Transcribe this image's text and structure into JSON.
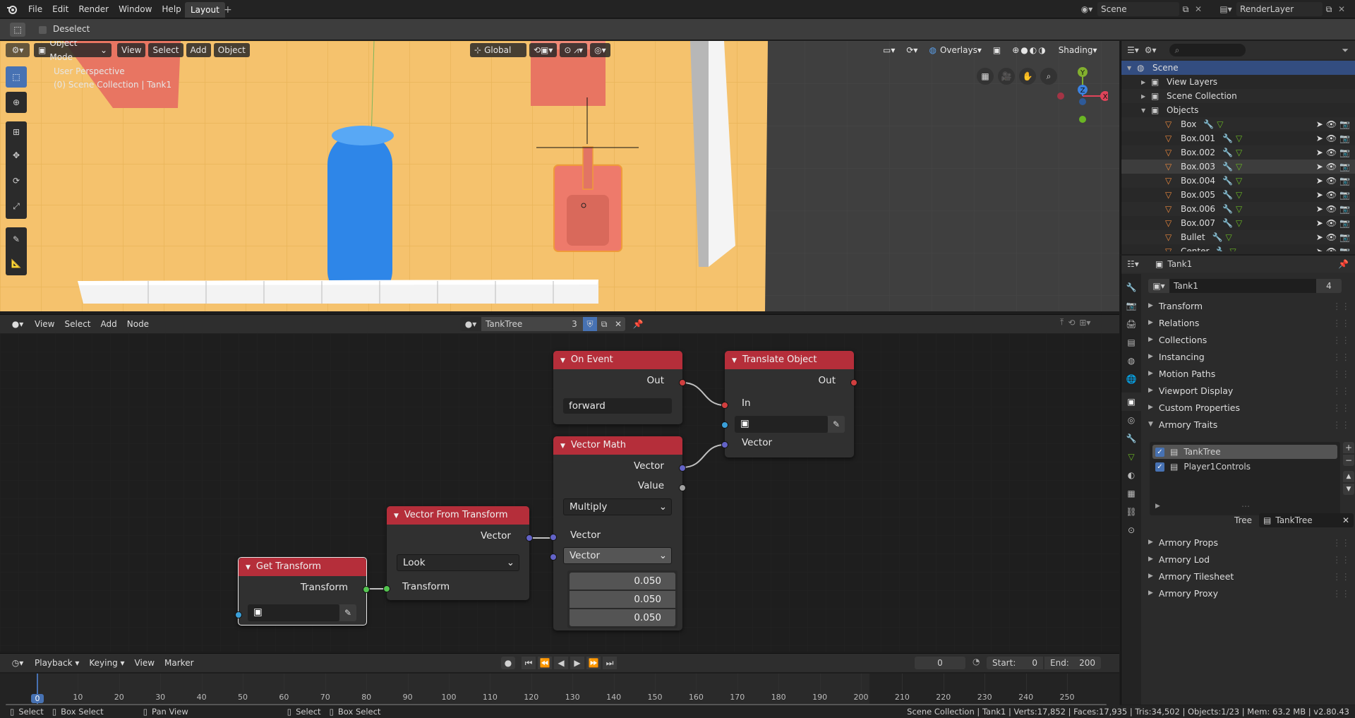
{
  "colors": {
    "accent": "#4772b3",
    "node_header": "#b52e3a",
    "selection": "#334d80"
  },
  "topbar": {
    "menus": [
      "File",
      "Edit",
      "Render",
      "Window",
      "Help"
    ],
    "workspace_tab": "Layout",
    "add_tab": "+",
    "scene": "Scene",
    "view_layer": "RenderLayer"
  },
  "toolheader": {
    "deselect": "Deselect"
  },
  "viewport": {
    "mode": "Object Mode",
    "menus": [
      "View",
      "Select",
      "Add",
      "Object"
    ],
    "orientation": "Global",
    "overlays": "Overlays",
    "shading": "Shading",
    "info_line1": "User Perspective",
    "info_line2": "(0) Scene Collection | Tank1",
    "gizmo": {
      "x": "X",
      "y": "Y",
      "z": "Z"
    }
  },
  "nodeeditor": {
    "menus": [
      "View",
      "Select",
      "Add",
      "Node"
    ],
    "tree_name": "TankTree",
    "users": "3",
    "nodes": {
      "on_event": {
        "title": "On Event",
        "out": "Out",
        "event": "forward"
      },
      "translate": {
        "title": "Translate Object",
        "out": "Out",
        "in": "In",
        "vector": "Vector"
      },
      "vector_math": {
        "title": "Vector Math",
        "out_vector": "Vector",
        "out_value": "Value",
        "op": "Multiply",
        "in_vector": "Vector",
        "in_vector2": "Vector",
        "values": [
          "0.050",
          "0.050",
          "0.050"
        ]
      },
      "vector_from_transform": {
        "title": "Vector From Transform",
        "out": "Vector",
        "mode": "Look",
        "in": "Transform"
      },
      "get_transform": {
        "title": "Get Transform",
        "out": "Transform"
      }
    }
  },
  "timeline": {
    "menus": [
      "Playback",
      "Keying",
      "View",
      "Marker"
    ],
    "current_frame": "0",
    "start_label": "Start:",
    "start": "0",
    "end_label": "End:",
    "end": "200",
    "ticks": [
      "0",
      "10",
      "20",
      "30",
      "40",
      "50",
      "60",
      "70",
      "80",
      "90",
      "100",
      "110",
      "120",
      "130",
      "140",
      "150",
      "160",
      "170",
      "180",
      "190",
      "200",
      "210",
      "220",
      "230",
      "240",
      "250"
    ],
    "playhead": "0"
  },
  "statusbar": {
    "hints": [
      {
        "key": "Select",
        "label": "Box Select"
      },
      {
        "key": "Pan View",
        "label": ""
      },
      {
        "key": "Select",
        "label": "Box Select"
      }
    ],
    "left1": "Select",
    "left2": "Box Select",
    "mid": "Pan View",
    "right1": "Select",
    "right2": "Box Select",
    "info": "Scene Collection | Tank1 | Verts:17,852 | Faces:17,935 | Tris:34,502 | Objects:1/23 | Mem: 63.2 MB | v2.80.43"
  },
  "outliner": {
    "search_placeholder": "",
    "items": [
      {
        "name": "Scene",
        "depth": 0
      },
      {
        "name": "View Layers",
        "depth": 1
      },
      {
        "name": "Scene Collection",
        "depth": 1
      },
      {
        "name": "Objects",
        "depth": 1
      },
      {
        "name": "Box",
        "depth": 2
      },
      {
        "name": "Box.001",
        "depth": 2
      },
      {
        "name": "Box.002",
        "depth": 2
      },
      {
        "name": "Box.003",
        "depth": 2
      },
      {
        "name": "Box.004",
        "depth": 2
      },
      {
        "name": "Box.005",
        "depth": 2
      },
      {
        "name": "Box.006",
        "depth": 2
      },
      {
        "name": "Box.007",
        "depth": 2
      },
      {
        "name": "Bullet",
        "depth": 2
      },
      {
        "name": "Center",
        "depth": 2
      }
    ]
  },
  "properties": {
    "object_name": "Tank1",
    "object_field": "Tank1",
    "users": "4",
    "panels_top": [
      "Transform",
      "Relations",
      "Collections",
      "Instancing",
      "Motion Paths",
      "Viewport Display",
      "Custom Properties",
      "Armory Traits"
    ],
    "traits": [
      {
        "name": "TankTree",
        "checked": true
      },
      {
        "name": "Player1Controls",
        "checked": true
      }
    ],
    "tree_label": "Tree",
    "tree_value": "TankTree",
    "panels_bottom": [
      "Armory Props",
      "Armory Lod",
      "Armory Tilesheet",
      "Armory Proxy"
    ]
  }
}
